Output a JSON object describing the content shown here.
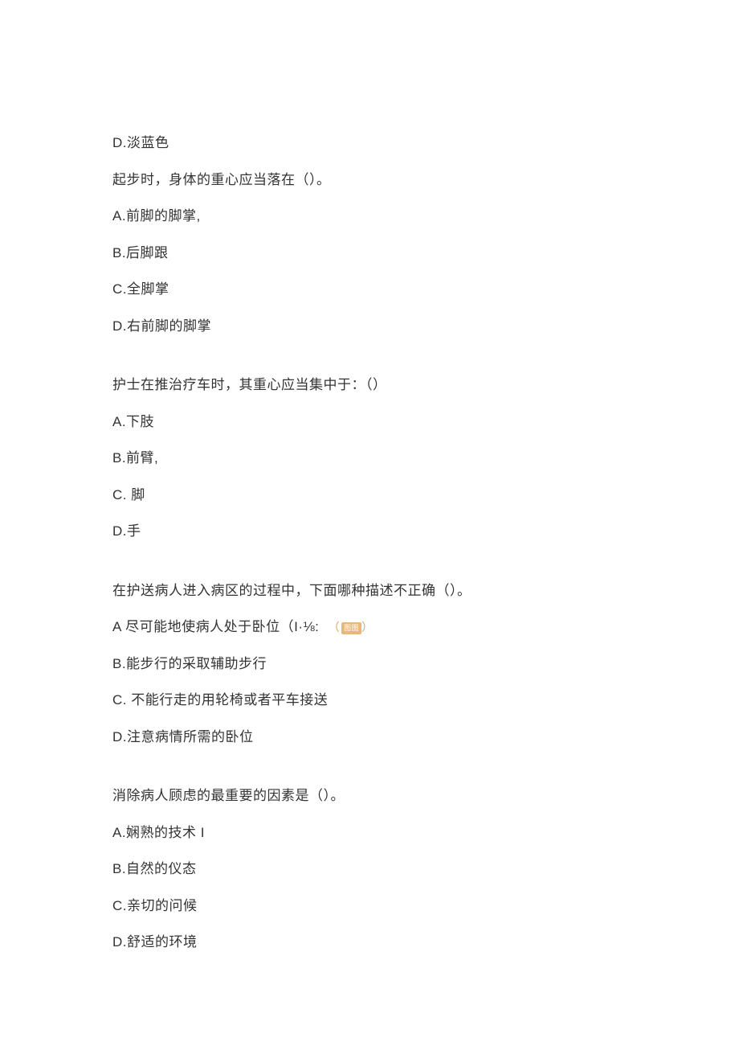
{
  "orphan_option": "D.淡蓝色",
  "q1": {
    "stem": "起步时，身体的重心应当落在（）。",
    "options": {
      "a": "A.前脚的脚掌,",
      "b": "B.后脚跟",
      "c": "C.全脚掌",
      "d": "D.右前脚的脚掌"
    }
  },
  "q2": {
    "stem": "护士在推治疗车时，其重心应当集中于：（）",
    "options": {
      "a": "A.下肢",
      "b": "B.前臂,",
      "c": "C. 脚",
      "d": "D.手"
    }
  },
  "q3": {
    "stem": "在护送病人进入病区的过程中，下面哪种描述不正确（）。",
    "options": {
      "a": "A 尽可能地使病人处于卧位（I·⅛:",
      "a_note_open": "（",
      "a_note_badge": "图图",
      "a_note_close": "）",
      "b": "B.能步行的采取辅助步行",
      "c": "C. 不能行走的用轮椅或者平车接送",
      "d": "D.注意病情所需的卧位"
    }
  },
  "q4": {
    "stem": "消除病人顾虑的最重要的因素是（）。",
    "options": {
      "a": "A.娴熟的技术 I",
      "b": "B.自然的仪态",
      "c": "C.亲切的问候",
      "d": "D.舒适的环境"
    }
  }
}
